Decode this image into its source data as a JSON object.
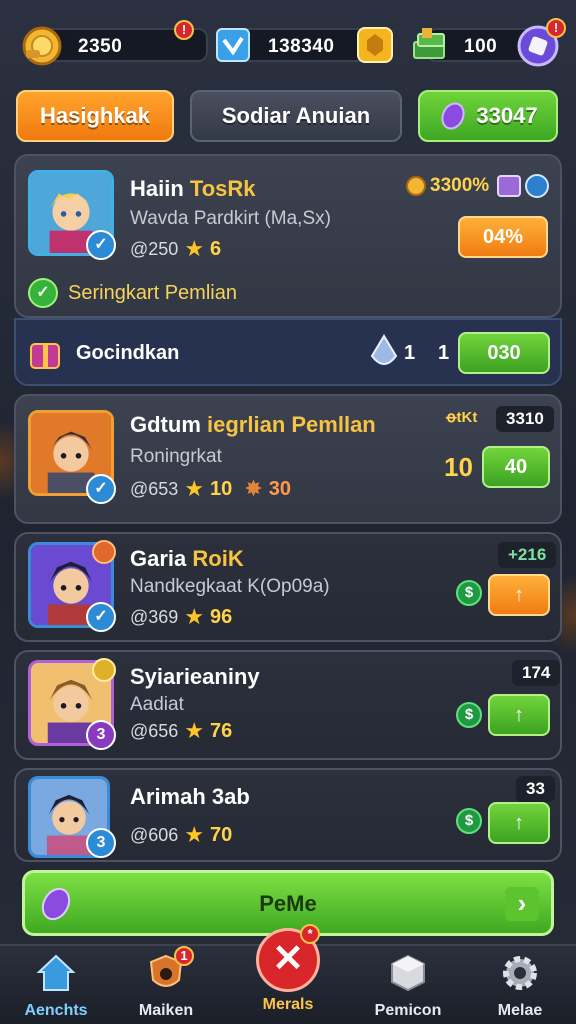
{
  "resources": [
    {
      "icon": "gold-coin-icon",
      "value": "2350"
    },
    {
      "icon": "gem-box-icon",
      "value": "138340"
    },
    {
      "icon": "cash-stack-icon",
      "value": "100"
    }
  ],
  "badges": {
    "resource_alert": "!",
    "nav_alert": "1",
    "nav_close_alert": "*"
  },
  "tabs": {
    "left": "Hasighkak",
    "middle": "Sodiar Anuian",
    "right": {
      "icon": "crystal-icon",
      "value": "33047"
    }
  },
  "featured": {
    "name_a": "Haiin",
    "name_b": "TosRk",
    "subtitle": "Wavda Pardkirt (Ma,Sx)",
    "stat": "@250",
    "stars": "6",
    "reward": "3300%",
    "button": "04%",
    "status": "Seringkart Pemlian"
  },
  "bonus_row": {
    "label": "Gocindkan",
    "a": "1",
    "b": "1",
    "button": "030"
  },
  "heroes": [
    {
      "name_a": "Gdtum",
      "name_b": "iegrlian Pemllan",
      "subtitle": "Roningrkat",
      "stat": "@653",
      "stars": "10",
      "extra": "30",
      "tag_label": "ꝋtKt",
      "tag": "3310",
      "level": "10",
      "button": "40"
    },
    {
      "name_a": "Garia",
      "name_b": "RoiK",
      "subtitle": "Nandkegkaat K(Op09a)",
      "stat": "@369",
      "stars": "96",
      "tag": "+216",
      "button": "↑"
    },
    {
      "name_a": "Syiarieaniny",
      "name_b": "",
      "subtitle": "Aadiat",
      "stat": "@656",
      "stars": "76",
      "tag": "174",
      "button": "↑"
    },
    {
      "name_a": "Arimah",
      "name_b": "3ab",
      "subtitle": "",
      "stat": "@606",
      "stars": "70",
      "tag": "33",
      "button": "↑"
    }
  ],
  "main_button": "PeMe",
  "nav": [
    {
      "icon": "home-icon",
      "label": "Aenchts"
    },
    {
      "icon": "shield-icon",
      "label": "Maiken"
    },
    {
      "icon": "close-icon",
      "label": "Merals"
    },
    {
      "icon": "cube-icon",
      "label": "Pemicon"
    },
    {
      "icon": "gear-icon",
      "label": "Melae"
    }
  ]
}
